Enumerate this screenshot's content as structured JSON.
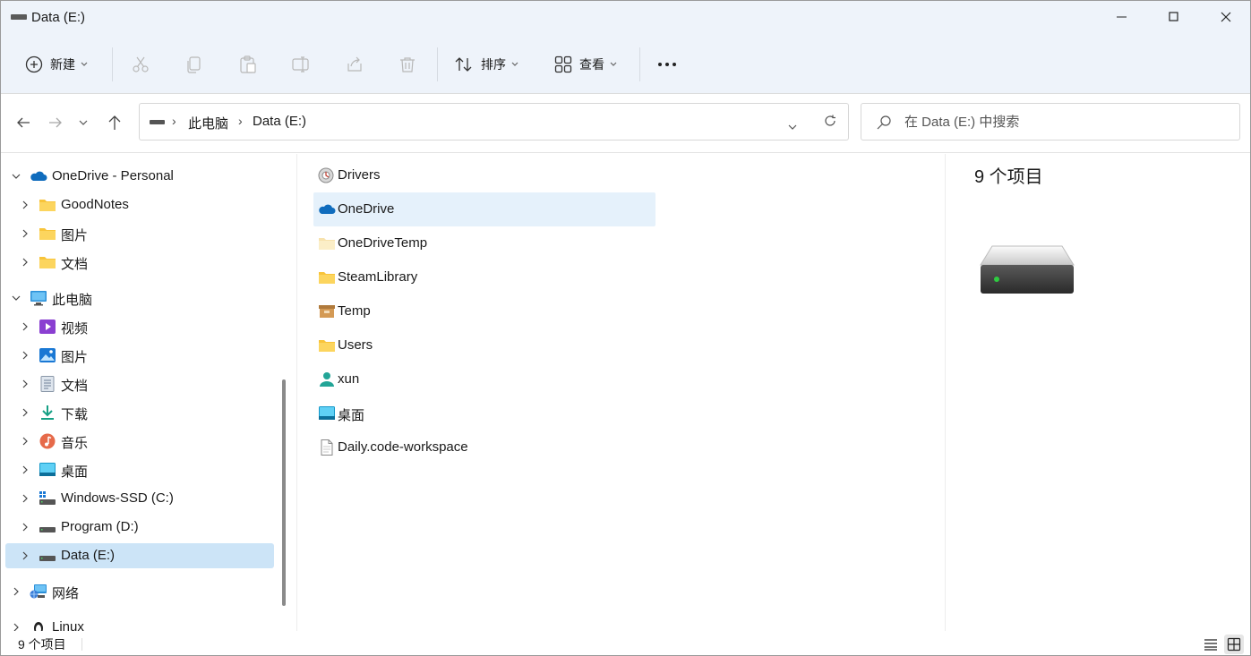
{
  "window": {
    "title": "Data (E:)"
  },
  "toolbar": {
    "new_label": "新建",
    "sort_label": "排序",
    "view_label": "查看"
  },
  "address": {
    "crumbs": [
      "此电脑",
      "Data (E:)"
    ]
  },
  "search": {
    "placeholder": "在 Data (E:) 中搜索"
  },
  "sidebar": {
    "items": [
      {
        "label": "OneDrive - Personal",
        "icon": "onedrive-cloud-icon",
        "expanded": true
      },
      {
        "label": "GoodNotes",
        "icon": "folder-icon"
      },
      {
        "label": "图片",
        "icon": "folder-icon"
      },
      {
        "label": "文档",
        "icon": "folder-icon"
      },
      {
        "label": "此电脑",
        "icon": "this-pc-icon",
        "expanded": true
      },
      {
        "label": "视频",
        "icon": "videos-icon"
      },
      {
        "label": "图片",
        "icon": "pictures-icon"
      },
      {
        "label": "文档",
        "icon": "documents-icon"
      },
      {
        "label": "下载",
        "icon": "downloads-icon"
      },
      {
        "label": "音乐",
        "icon": "music-icon"
      },
      {
        "label": "桌面",
        "icon": "desktop-icon"
      },
      {
        "label": "Windows-SSD (C:)",
        "icon": "windows-drive-icon"
      },
      {
        "label": "Program (D:)",
        "icon": "drive-icon"
      },
      {
        "label": "Data (E:)",
        "icon": "drive-icon",
        "selected": true
      },
      {
        "label": "网络",
        "icon": "network-icon"
      },
      {
        "label": "Linux",
        "icon": "linux-penguin-icon"
      }
    ]
  },
  "files": [
    {
      "name": "Drivers",
      "icon": "drivers-folder-icon"
    },
    {
      "name": "OneDrive",
      "icon": "onedrive-cloud-icon",
      "selected": true
    },
    {
      "name": "OneDriveTemp",
      "icon": "folder-light-icon"
    },
    {
      "name": "SteamLibrary",
      "icon": "folder-icon"
    },
    {
      "name": "Temp",
      "icon": "archive-folder-icon"
    },
    {
      "name": "Users",
      "icon": "folder-icon"
    },
    {
      "name": "xun",
      "icon": "user-icon"
    },
    {
      "name": "桌面",
      "icon": "desktop-icon"
    },
    {
      "name": "Daily.code-workspace",
      "icon": "file-icon"
    }
  ],
  "details": {
    "count_label": "9 个项目"
  },
  "status": {
    "count_label": "9 个项目"
  },
  "colors": {
    "accent": "#0067c0",
    "selected_bg": "#cce4f7",
    "hover_bg": "#e5f1fb",
    "folder": "#f8c43a"
  }
}
